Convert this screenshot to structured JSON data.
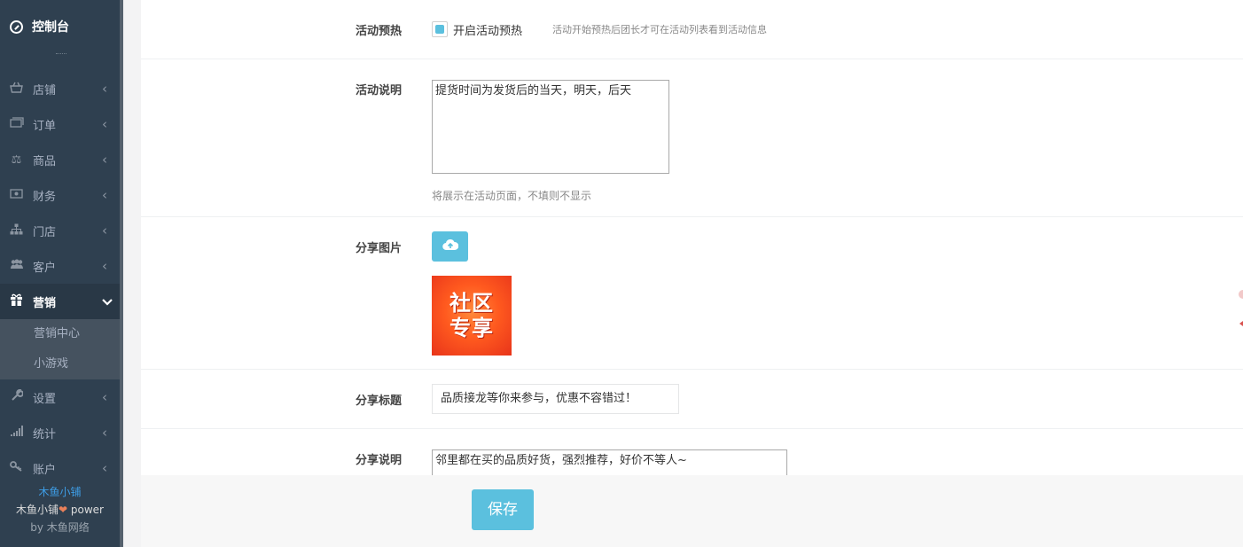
{
  "sidebar": {
    "brand": "控制台",
    "items": [
      {
        "icon": "shop-basket-icon",
        "label": "店铺"
      },
      {
        "icon": "money-icon",
        "label": "订单"
      },
      {
        "icon": "scale-icon",
        "label": "商品"
      },
      {
        "icon": "cash-icon",
        "label": "财务"
      },
      {
        "icon": "sitemap-icon",
        "label": "门店"
      },
      {
        "icon": "users-icon",
        "label": "客户"
      },
      {
        "icon": "gift-icon",
        "label": "营销"
      },
      {
        "icon": "wrench-icon",
        "label": "设置"
      },
      {
        "icon": "signal-icon",
        "label": "统计"
      },
      {
        "icon": "key-icon",
        "label": "账户"
      }
    ],
    "submenu": [
      "营销中心",
      "小游戏"
    ],
    "footer": {
      "line1": "木鱼小铺",
      "line2_prefix": "木鱼小铺",
      "line2_suffix": " power",
      "line3_prefix": "by ",
      "line3_name": "木鱼网络"
    }
  },
  "form": {
    "preheat": {
      "label": "活动预热",
      "checkbox_label": "开启活动预热",
      "checked": true,
      "hint": "活动开始预热后团长才可在活动列表看到活动信息"
    },
    "description": {
      "label": "活动说明",
      "value": "提货时间为发货后的当天，明天，后天",
      "hint": "将展示在活动页面，不填则不显示"
    },
    "share_image": {
      "label": "分享图片",
      "upload_icon": "cloud-upload-icon",
      "image_text_line1": "社区",
      "image_text_line2": "专享"
    },
    "share_title": {
      "label": "分享标题",
      "value": "品质接龙等你来参与，优惠不容错过！"
    },
    "share_desc": {
      "label": "分享说明",
      "value": "邻里都在买的品质好货，强烈推荐，好价不等人~"
    },
    "save_label": "保存"
  },
  "colors": {
    "sidebar_bg": "#2f4050",
    "accent": "#5bc0de"
  }
}
